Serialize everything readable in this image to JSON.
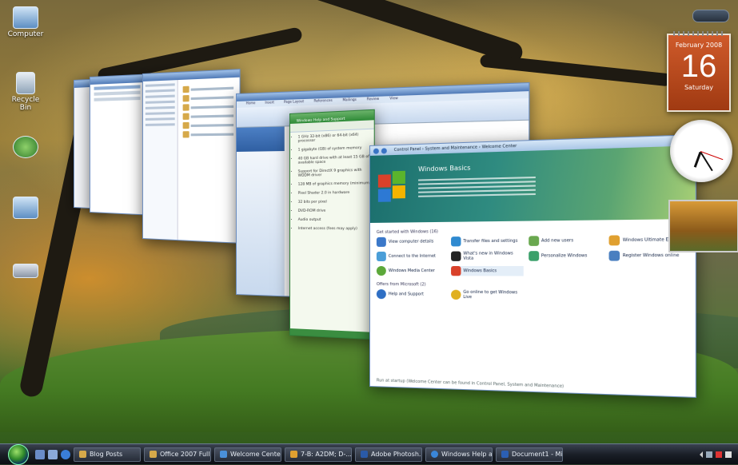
{
  "desktop": {
    "icons": [
      {
        "label": "Computer",
        "name": "computer"
      },
      {
        "label": "Recycle Bin",
        "name": "recycle-bin"
      },
      {
        "label": "",
        "name": "network"
      },
      {
        "label": "",
        "name": "documents"
      },
      {
        "label": "",
        "name": "drive"
      }
    ]
  },
  "gadgets": {
    "calendar": {
      "month": "February 2008",
      "day": "16",
      "weekday": "Saturday"
    }
  },
  "windows": {
    "control_panel": {
      "banner_title": "Windows Basics",
      "breadcrumb": "Control Panel › System and Maintenance › Welcome Center",
      "section1": "Get started with Windows (16)",
      "section2": "Offers from Microsoft (2)",
      "items": [
        "View computer details",
        "Transfer files and settings",
        "Add new users",
        "Windows Ultimate Extras",
        "Connect to the Internet",
        "What's new in Windows Vista",
        "Personalize Windows",
        "Register Windows online",
        "Windows Media Center",
        "Windows Basics",
        "Help and Support",
        "Go online to get Windows Live"
      ],
      "footer": "Run at startup (Welcome Center can be found in Control Panel, System and Maintenance)"
    },
    "help": {
      "title": "Windows Help and Support",
      "bullets": [
        "1 GHz 32-bit (x86) or 64-bit (x64) processor",
        "1 gigabyte (GB) of system memory",
        "40 GB hard drive with at least 15 GB of available space",
        "Support for DirectX 9 graphics with WDDM driver",
        "128 MB of graphics memory (minimum)",
        "Pixel Shader 2.0 in hardware",
        "32 bits per pixel",
        "DVD-ROM drive",
        "Audio output",
        "Internet access (fees may apply)"
      ]
    },
    "word": {
      "tabs": [
        "Home",
        "Insert",
        "Page Layout",
        "References",
        "Mailings",
        "Review",
        "View"
      ]
    }
  },
  "taskbar": {
    "buttons": [
      {
        "label": "Blog Posts",
        "color": "#d6a94a"
      },
      {
        "label": "Office 2007 Full",
        "color": "#d6a94a"
      },
      {
        "label": "Welcome Center",
        "color": "#4a90d9"
      },
      {
        "label": "7-B: A2DM; D-...",
        "color": "#e0a030"
      },
      {
        "label": "Adobe Photosh...",
        "color": "#2a5aa8"
      },
      {
        "label": "Windows Help a...",
        "color": "#3a86d8"
      },
      {
        "label": "Document1 - Mi...",
        "color": "#2b5fb3"
      }
    ]
  }
}
